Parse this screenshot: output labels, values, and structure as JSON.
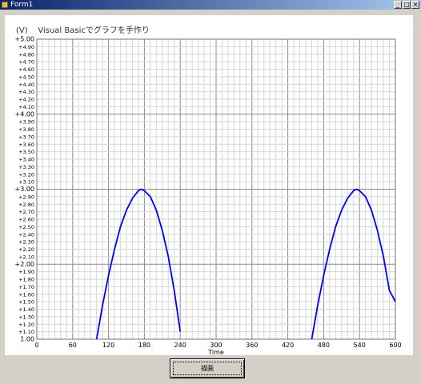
{
  "window": {
    "title": "Form1"
  },
  "chart_title": "(V)    Visual Basicでグラフを手作り",
  "button_label": "描画",
  "chart_data": {
    "type": "line",
    "title": "Visual Basicでグラフを手作り",
    "ylabel": "(V)",
    "xlabel": "Time",
    "xlim": [
      0,
      600
    ],
    "ylim": [
      1.0,
      5.0
    ],
    "x_ticks": [
      0,
      60,
      120,
      180,
      240,
      300,
      360,
      420,
      480,
      540,
      600
    ],
    "x_tick_labels": [
      "0",
      "60",
      "120",
      "180",
      "240",
      "300",
      "360",
      "420",
      "480",
      "540",
      "600"
    ],
    "y_tick_step": 0.1,
    "y_major_ticks": [
      1.0,
      2.0,
      3.0,
      4.0,
      5.0
    ],
    "grid": true,
    "series": [
      {
        "color": "#0000ff",
        "x": [
          100,
          110,
          120,
          130,
          140,
          150,
          160,
          170,
          175,
          180,
          190,
          200,
          210,
          220,
          230,
          240,
          460,
          470,
          480,
          490,
          500,
          510,
          520,
          530,
          535,
          540,
          550,
          560,
          570,
          580,
          590,
          600
        ],
        "y": [
          1.0,
          1.45,
          1.85,
          2.2,
          2.5,
          2.72,
          2.88,
          2.98,
          3.0,
          2.98,
          2.9,
          2.72,
          2.45,
          2.1,
          1.65,
          1.1,
          1.0,
          1.45,
          1.85,
          2.2,
          2.5,
          2.72,
          2.88,
          2.98,
          3.0,
          2.98,
          2.9,
          2.72,
          2.45,
          2.1,
          1.65,
          1.5
        ]
      }
    ]
  }
}
